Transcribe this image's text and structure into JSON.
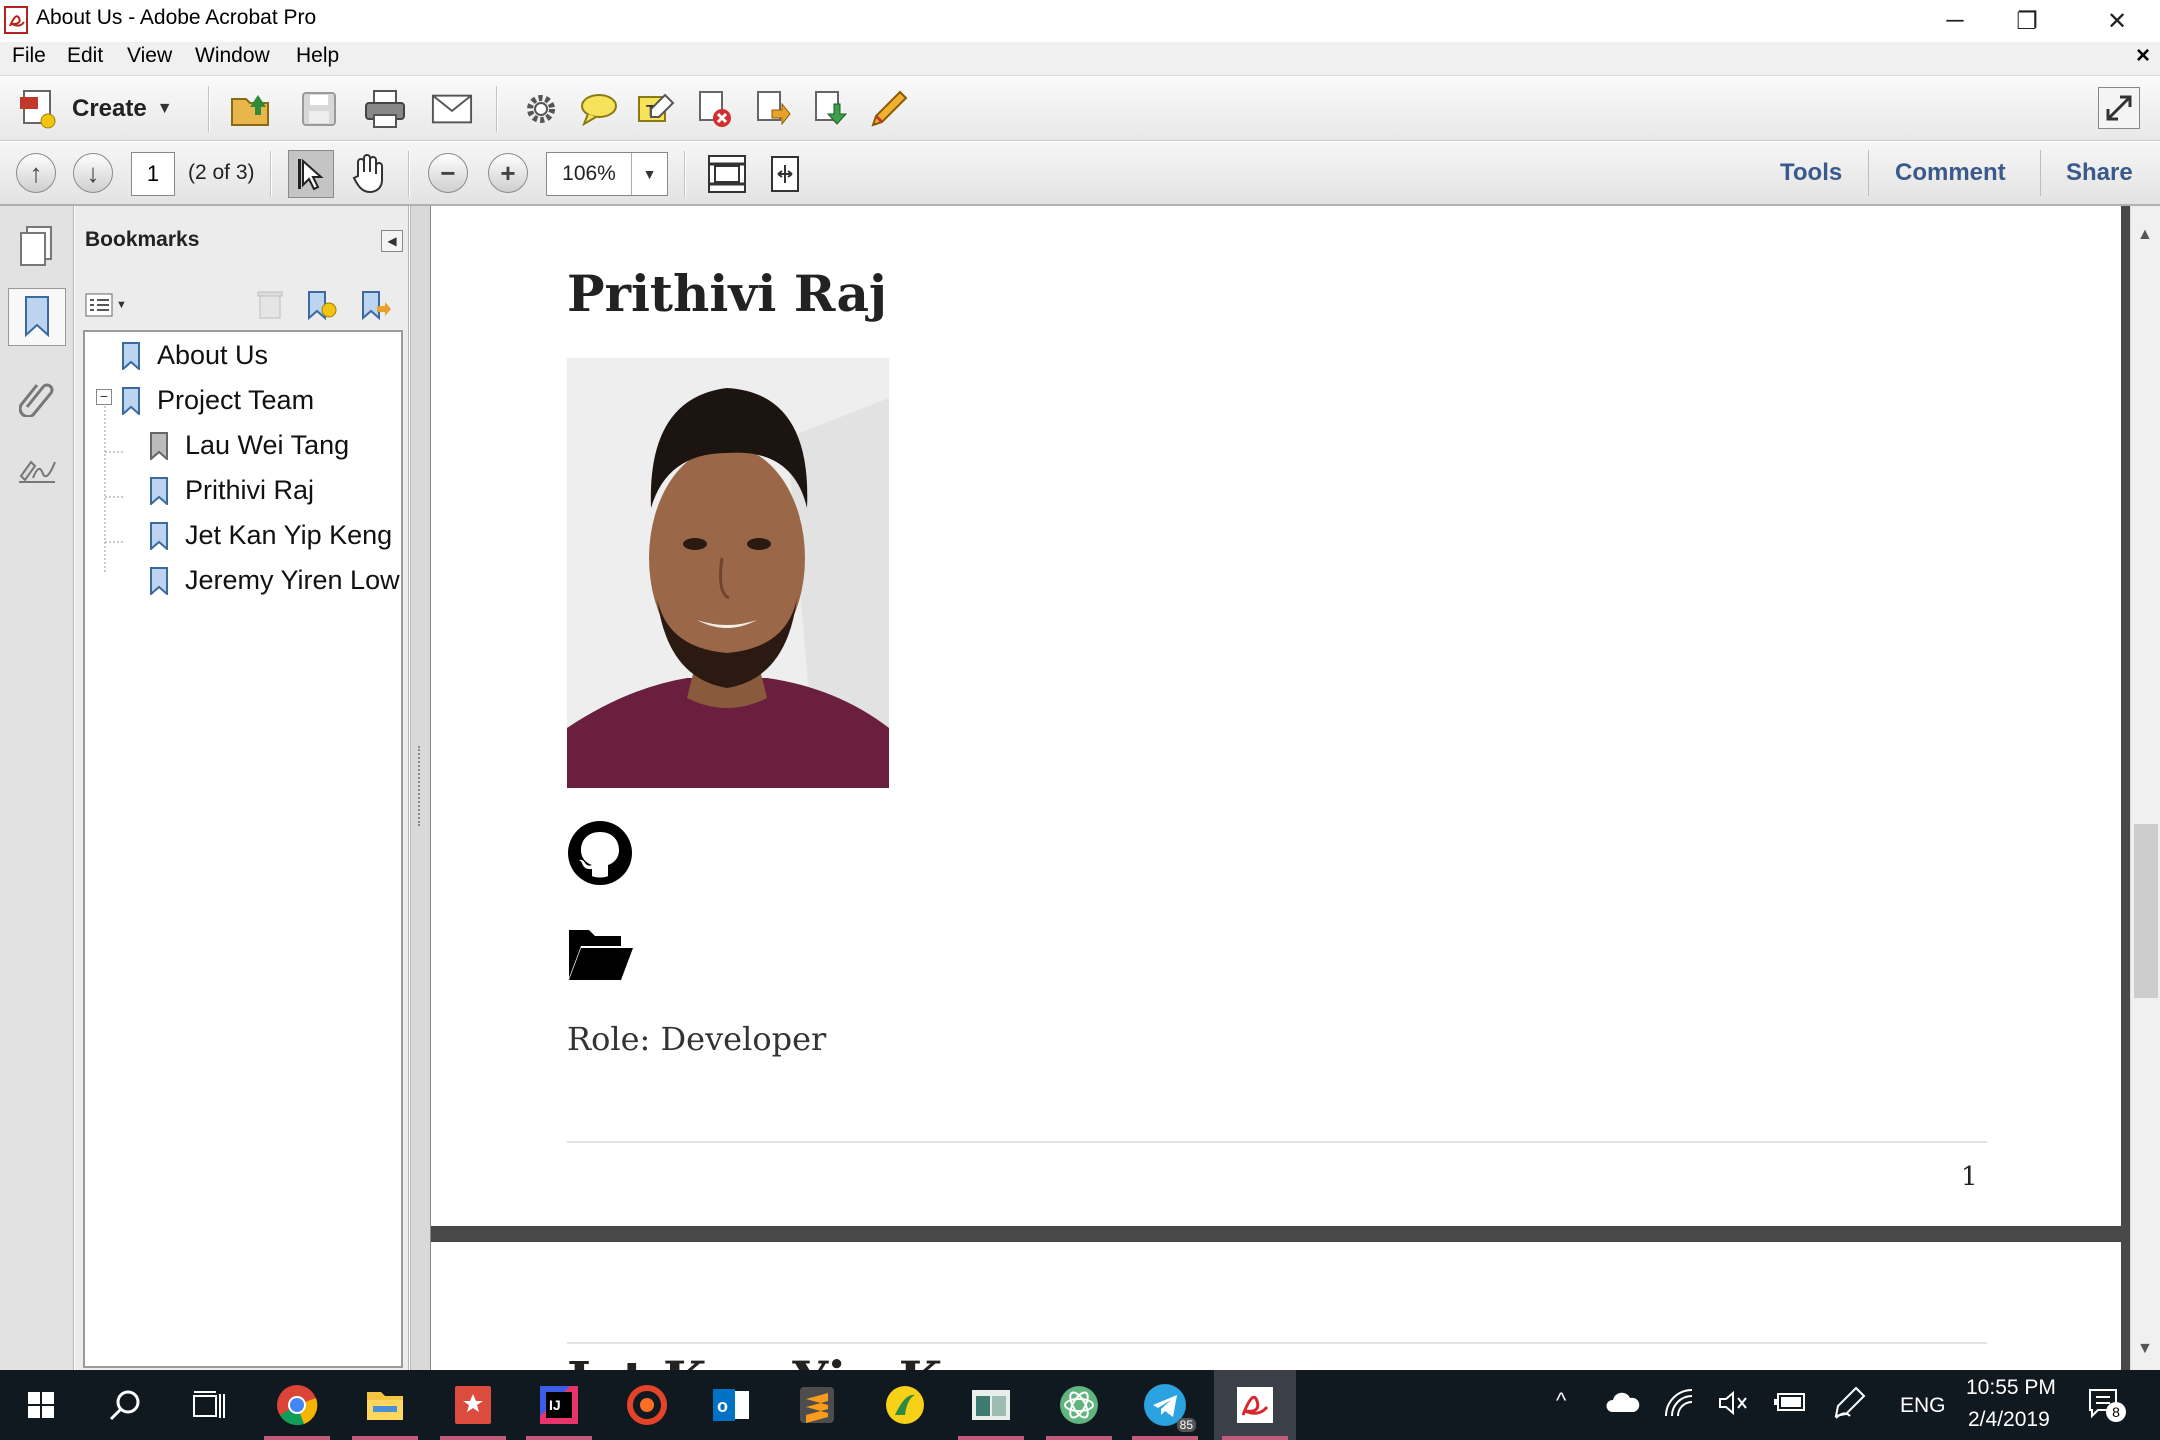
{
  "window": {
    "title": "About Us - Adobe Acrobat Pro",
    "minimize_icon": "minimize-icon",
    "restore_icon": "restore-icon",
    "close_icon": "close-icon"
  },
  "menubar": {
    "items": [
      "File",
      "Edit",
      "View",
      "Window",
      "Help"
    ],
    "close_label": "×"
  },
  "toolbar1": {
    "create_label": "Create"
  },
  "toolbar2": {
    "page_value": "1",
    "page_count": "(2 of 3)",
    "zoom_value": "106%",
    "tools_label": "Tools",
    "comment_label": "Comment",
    "share_label": "Share"
  },
  "bookmarks": {
    "header": "Bookmarks",
    "items": [
      {
        "label": "About Us",
        "level": 0
      },
      {
        "label": "Project Team",
        "level": 0,
        "expanded": true
      },
      {
        "label": "Lau Wei Tang",
        "level": 1
      },
      {
        "label": "Prithivi Raj",
        "level": 1
      },
      {
        "label": "Jet Kan Yip Keng",
        "level": 1
      },
      {
        "label": "Jeremy Yiren Low",
        "level": 1
      }
    ]
  },
  "document": {
    "name": "Prithivi Raj",
    "role": "Role: Developer",
    "page_number": "1",
    "next_heading_partial": "Jet Kan Yip Keng"
  },
  "taskbar": {
    "language": "ENG",
    "time": "10:55 PM",
    "date": "2/4/2019",
    "notifications": "8",
    "telegram_badge": "85"
  },
  "colors": {
    "accent_link": "#3a5a8c",
    "taskbar_bg": "#101820",
    "doc_bg": "#484848"
  }
}
